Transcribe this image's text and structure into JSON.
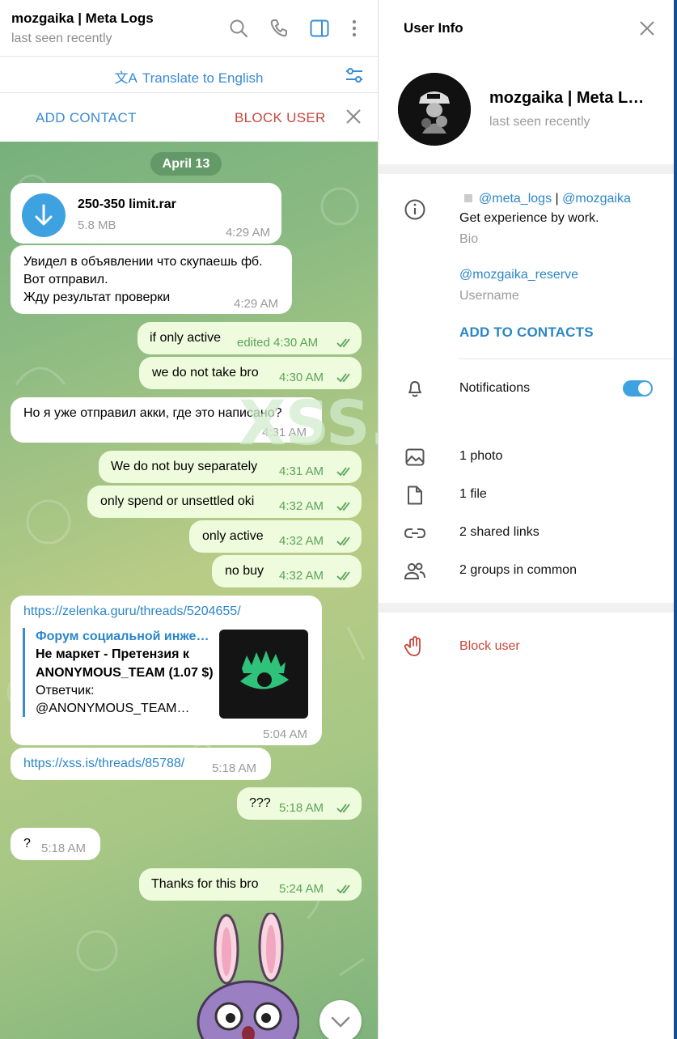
{
  "header": {
    "title": "mozgaika | Meta Logs",
    "status": "last seen recently"
  },
  "translate_bar": {
    "label": "Translate to English"
  },
  "action_bar": {
    "add_contact": "ADD CONTACT",
    "block_user": "BLOCK USER"
  },
  "chat": {
    "date": "April 13",
    "file": {
      "name": "250-350 limit.rar",
      "size": "5.8 MB",
      "time": "4:29 AM"
    },
    "msg_ru1": {
      "line1": "Увидел в объявлении  что  скупаешь фб.",
      "line2": "Вот отправил.",
      "line3": "Жду результат проверки",
      "time": "4:29 AM"
    },
    "out1": {
      "text": "if only active",
      "time": "edited 4:30 AM"
    },
    "out2": {
      "text": "we do not take bro",
      "time": "4:30 AM"
    },
    "in_ru2": {
      "text": "Но я уже отправил акки, где это написано?",
      "time": "4:31 AM"
    },
    "out3": {
      "text": "We do not buy separately",
      "time": "4:31 AM"
    },
    "out4": {
      "text": "only spend or unsettled oki",
      "time": "4:32 AM"
    },
    "out5": {
      "text": "only active",
      "time": "4:32 AM"
    },
    "out6": {
      "text": "no buy",
      "time": "4:32 AM"
    },
    "link1": {
      "url": "https://zelenka.guru/threads/5204655/",
      "site": "Форум социальной инже…",
      "title1": "Не маркет - Претензия к",
      "title2": "ANONYMOUS_TEAM (1.07 $)",
      "desc1": "Ответчик:",
      "desc2": "@ANONYMOUS_TEAM…",
      "time": "5:04 AM"
    },
    "link2": {
      "url": "https://xss.is/threads/85788/",
      "time": "5:18 AM"
    },
    "out7": {
      "text": "???",
      "time": "5:18 AM"
    },
    "in3": {
      "text": "?",
      "time": "5:18 AM"
    },
    "out8": {
      "text": "Thanks for this bro",
      "time": "5:24 AM"
    },
    "watermark": "XSS.is"
  },
  "info": {
    "title": "User Info",
    "name": "mozgaika | Meta L…",
    "status": "last seen recently",
    "bio_links": {
      "link1": "@meta_logs",
      "sep": "|",
      "link2": "@mozgaika"
    },
    "bio_text": "Get experience by work.",
    "bio_label": "Bio",
    "username": "@mozgaika_reserve",
    "username_label": "Username",
    "add_to_contacts": "ADD TO CONTACTS",
    "notifications": "Notifications",
    "notifications_on": true,
    "media": {
      "photos": "1 photo",
      "files": "1 file",
      "links": "2 shared links",
      "groups": "2 groups in common"
    },
    "block": "Block user"
  },
  "colors": {
    "accent": "#3a8bd0",
    "danger": "#c9473c",
    "outgoing": "#eefbdc",
    "check": "#5aa45b"
  }
}
